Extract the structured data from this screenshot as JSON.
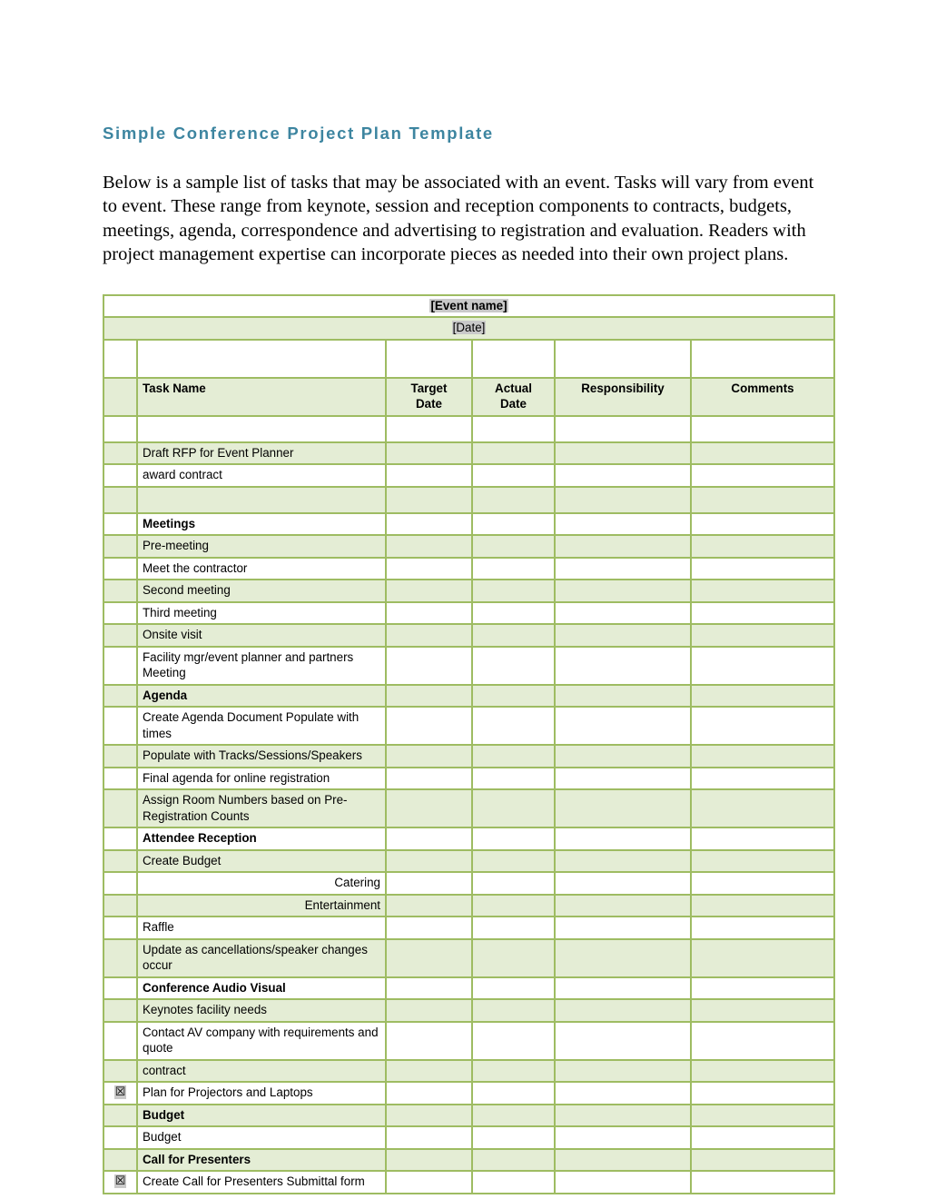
{
  "document": {
    "title": "Simple Conference Project Plan Template",
    "intro": "Below is a sample list of tasks that may be associated with an event.  Tasks will vary from event to event.  These range from keynote, session and reception components to contracts, budgets, meetings, agenda, correspondence and advertising to registration and evaluation. Readers with project management expertise can incorporate pieces as needed into their own project plans."
  },
  "colors": {
    "title_color": "#3D85A0",
    "table_border": "#9EBC62",
    "row_fill_green": "#E4EDD5",
    "row_fill_white": "#FFFFFF",
    "field_shade": "#C9C9C9"
  },
  "table": {
    "banner_event": "[Event name]",
    "banner_date": "[Date]",
    "columns": {
      "checkbox": "",
      "task_name": "Task Name",
      "target_date": "Target Date",
      "target_date_line1": "Target",
      "target_date_line2": "Date",
      "actual_date": "Actual Date",
      "actual_date_line1": "Actual",
      "actual_date_line2": "Date",
      "responsibility": "Responsibility",
      "comments": "Comments"
    },
    "checkbox_glyph": "☒",
    "rows": [
      {
        "id": "r01",
        "fill": "white",
        "kind": "spacer",
        "checkbox": "",
        "task": "",
        "align": "left",
        "bold": false
      },
      {
        "id": "r02",
        "fill": "green",
        "kind": "task",
        "checkbox": "",
        "task": "Draft RFP for Event Planner",
        "align": "left",
        "bold": false
      },
      {
        "id": "r03",
        "fill": "white",
        "kind": "task",
        "checkbox": "",
        "task": "award contract",
        "align": "left",
        "bold": false
      },
      {
        "id": "r04",
        "fill": "green",
        "kind": "spacer",
        "checkbox": "",
        "task": "",
        "align": "left",
        "bold": false
      },
      {
        "id": "r05",
        "fill": "white",
        "kind": "task",
        "checkbox": "",
        "task": "Meetings",
        "align": "left",
        "bold": true
      },
      {
        "id": "r06",
        "fill": "green",
        "kind": "task",
        "checkbox": "",
        "task": "Pre-meeting",
        "align": "left",
        "bold": false
      },
      {
        "id": "r07",
        "fill": "white",
        "kind": "task",
        "checkbox": "",
        "task": "Meet the contractor",
        "align": "left",
        "bold": false
      },
      {
        "id": "r08",
        "fill": "green",
        "kind": "task",
        "checkbox": "",
        "task": "Second meeting",
        "align": "left",
        "bold": false
      },
      {
        "id": "r09",
        "fill": "white",
        "kind": "task",
        "checkbox": "",
        "task": "Third meeting",
        "align": "left",
        "bold": false
      },
      {
        "id": "r10",
        "fill": "green",
        "kind": "task",
        "checkbox": "",
        "task": "Onsite visit",
        "align": "left",
        "bold": false
      },
      {
        "id": "r11",
        "fill": "white",
        "kind": "task",
        "checkbox": "",
        "task": "Facility  mgr/event planner and partners Meeting",
        "align": "left",
        "bold": false
      },
      {
        "id": "r12",
        "fill": "green",
        "kind": "task",
        "checkbox": "",
        "task": "Agenda",
        "align": "left",
        "bold": true
      },
      {
        "id": "r13",
        "fill": "white",
        "kind": "task",
        "checkbox": "",
        "task": "Create Agenda Document Populate with times",
        "align": "left",
        "bold": false
      },
      {
        "id": "r14",
        "fill": "green",
        "kind": "task",
        "checkbox": "",
        "task": "Populate with Tracks/Sessions/Speakers",
        "align": "left",
        "bold": false
      },
      {
        "id": "r15",
        "fill": "white",
        "kind": "task",
        "checkbox": "",
        "task": "Final agenda for online registration",
        "align": "left",
        "bold": false
      },
      {
        "id": "r16",
        "fill": "green",
        "kind": "task",
        "checkbox": "",
        "task": "Assign Room Numbers based on Pre-Registration Counts",
        "align": "left",
        "bold": false
      },
      {
        "id": "r17",
        "fill": "white",
        "kind": "task",
        "checkbox": "",
        "task": "Attendee Reception",
        "align": "left",
        "bold": true
      },
      {
        "id": "r18",
        "fill": "green",
        "kind": "task",
        "checkbox": "",
        "task": "Create  Budget",
        "align": "left",
        "bold": false
      },
      {
        "id": "r19",
        "fill": "white",
        "kind": "task",
        "checkbox": "",
        "task": "Catering",
        "align": "right",
        "bold": false
      },
      {
        "id": "r20",
        "fill": "green",
        "kind": "task",
        "checkbox": "",
        "task": "Entertainment",
        "align": "right",
        "bold": false
      },
      {
        "id": "r21",
        "fill": "white",
        "kind": "task",
        "checkbox": "",
        "task": "Raffle",
        "align": "left",
        "bold": false
      },
      {
        "id": "r22",
        "fill": "green",
        "kind": "task",
        "checkbox": "",
        "task": "Update as cancellations/speaker changes occur",
        "align": "left",
        "bold": false
      },
      {
        "id": "r23",
        "fill": "white",
        "kind": "task",
        "checkbox": "",
        "task": "Conference Audio Visual",
        "align": "left",
        "bold": true
      },
      {
        "id": "r24",
        "fill": "green",
        "kind": "task",
        "checkbox": "",
        "task": " Keynotes facility needs",
        "align": "left",
        "bold": false
      },
      {
        "id": "r25",
        "fill": "white",
        "kind": "task",
        "checkbox": "",
        "task": "Contact AV company with requirements and quote",
        "align": "left",
        "bold": false
      },
      {
        "id": "r26",
        "fill": "green",
        "kind": "task",
        "checkbox": "",
        "task": "contract",
        "align": "left",
        "bold": false
      },
      {
        "id": "r27",
        "fill": "white",
        "kind": "task",
        "checkbox": "☒",
        "task": "Plan for  Projectors and Laptops",
        "align": "left",
        "bold": false
      },
      {
        "id": "r28",
        "fill": "green",
        "kind": "task",
        "checkbox": "",
        "task": "Budget",
        "align": "left",
        "bold": true
      },
      {
        "id": "r29",
        "fill": "white",
        "kind": "task",
        "checkbox": "",
        "task": " Budget",
        "align": "left",
        "bold": false
      },
      {
        "id": "r30",
        "fill": "green",
        "kind": "task",
        "checkbox": "",
        "task": "Call for Presenters",
        "align": "left",
        "bold": true
      },
      {
        "id": "r31",
        "fill": "white",
        "kind": "task",
        "checkbox": "☒",
        "task": "Create Call for Presenters Submittal form",
        "align": "left",
        "bold": false
      }
    ]
  }
}
